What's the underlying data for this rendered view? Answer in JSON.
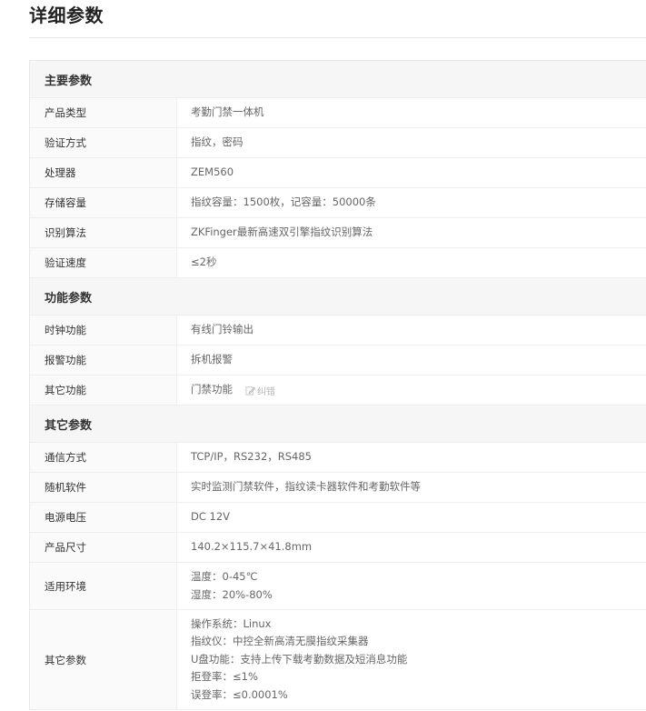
{
  "page": {
    "title": "详细参数"
  },
  "sections": [
    {
      "title": "主要参数",
      "rows": [
        {
          "key": "产品类型",
          "values": [
            "考勤门禁一体机"
          ]
        },
        {
          "key": "验证方式",
          "values": [
            "指纹，密码"
          ]
        },
        {
          "key": "处理器",
          "values": [
            "ZEM560"
          ]
        },
        {
          "key": "存储容量",
          "values": [
            "指纹容量：1500枚，记容量：50000条"
          ]
        },
        {
          "key": "识别算法",
          "values": [
            "ZKFinger最新高速双引擎指纹识别算法"
          ]
        },
        {
          "key": "验证速度",
          "values": [
            "≤2秒"
          ]
        }
      ]
    },
    {
      "title": "功能参数",
      "rows": [
        {
          "key": "时钟功能",
          "values": [
            "有线门铃输出"
          ]
        },
        {
          "key": "报警功能",
          "values": [
            "拆机报警"
          ]
        },
        {
          "key": "其它功能",
          "values": [
            "门禁功能"
          ],
          "correct_label": "纠错"
        }
      ]
    },
    {
      "title": "其它参数",
      "rows": [
        {
          "key": "通信方式",
          "values": [
            "TCP/IP，RS232，RS485"
          ]
        },
        {
          "key": "随机软件",
          "values": [
            "实时监测门禁软件，指纹读卡器软件和考勤软件等"
          ]
        },
        {
          "key": "电源电压",
          "values": [
            "DC 12V"
          ]
        },
        {
          "key": "产品尺寸",
          "values": [
            "140.2×115.7×41.8mm"
          ]
        },
        {
          "key": "适用环境",
          "values": [
            "温度：0-45℃",
            "湿度：20%-80%"
          ]
        },
        {
          "key": "其它参数",
          "values": [
            "操作系统：Linux",
            "指纹仪：中控全新高清无膜指纹采集器",
            "U盘功能：支持上传下载考勤数据及短消息功能",
            "拒登率：≤1%",
            "误登率：≤0.0001%"
          ]
        }
      ]
    }
  ]
}
